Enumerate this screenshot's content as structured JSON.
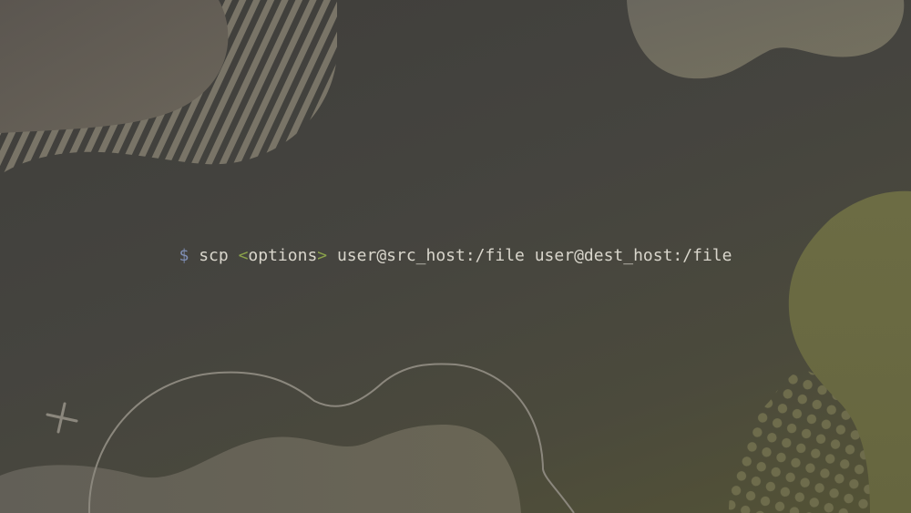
{
  "command": {
    "prompt": "$",
    "program": "scp",
    "options_open": "<",
    "options_word": "options",
    "options_close": ">",
    "source": "user@src_host:/file",
    "destination": "user@dest_host:/file"
  },
  "colors": {
    "prompt": "#7f8fb5",
    "program": "#d9d6cc",
    "bracket": "#8aa24a",
    "argument": "#d9d6cc"
  },
  "decorations": [
    "blob-shape",
    "diagonal-stripe-pattern",
    "outline-cloud-curve",
    "plus-sign-icon",
    "dot-halftone-pattern"
  ]
}
